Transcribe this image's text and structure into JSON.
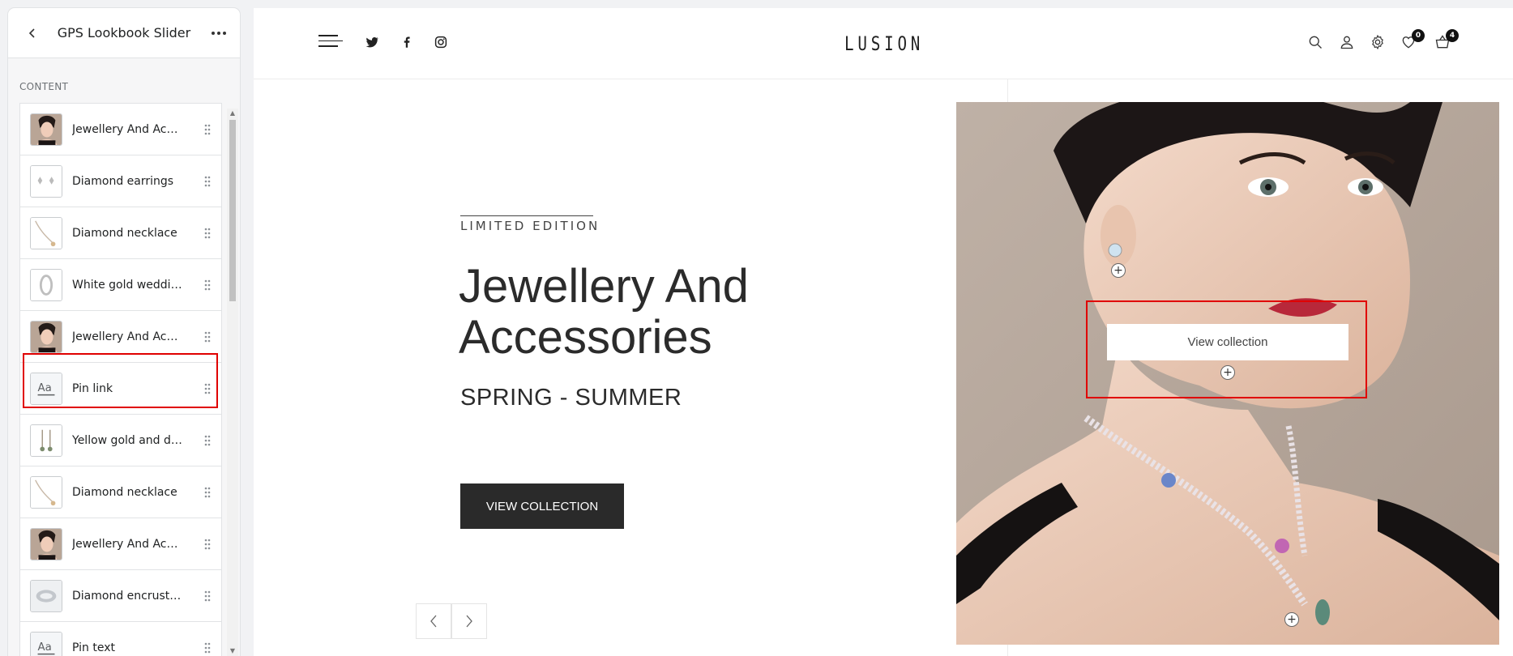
{
  "sidebar": {
    "title": "GPS Lookbook Slider",
    "section_label": "CONTENT",
    "items": [
      {
        "label": "Jewellery And Acces...",
        "thumb": "woman-portrait"
      },
      {
        "label": "Diamond earrings",
        "thumb": "earrings"
      },
      {
        "label": "Diamond necklace",
        "thumb": "necklace"
      },
      {
        "label": "White gold wedding...",
        "thumb": "ring"
      },
      {
        "label": "Jewellery And Acces...",
        "thumb": "woman-portrait"
      },
      {
        "label": "Pin link",
        "thumb": "text-block-icon"
      },
      {
        "label": "Yellow gold and dia...",
        "thumb": "drop-earrings"
      },
      {
        "label": "Diamond necklace",
        "thumb": "necklace"
      },
      {
        "label": "Jewellery And Acces...",
        "thumb": "woman-portrait"
      },
      {
        "label": "Diamond encrusted",
        "thumb": "bracelet"
      },
      {
        "label": "Pin text",
        "thumb": "text-block-icon"
      }
    ],
    "highlighted_item": "Pin link"
  },
  "header": {
    "logo": "LUSION",
    "wishlist_count": "0",
    "cart_count": "4"
  },
  "hero": {
    "eyebrow": "LIMITED EDITION",
    "title_line1": "Jewellery And",
    "title_line2": "Accessories",
    "subtitle": "SPRING - SUMMER",
    "cta": "VIEW COLLECTION",
    "tooltip": "View collection"
  },
  "colors": {
    "highlight": "#e00000",
    "cta_bg": "#2a2a2a"
  }
}
